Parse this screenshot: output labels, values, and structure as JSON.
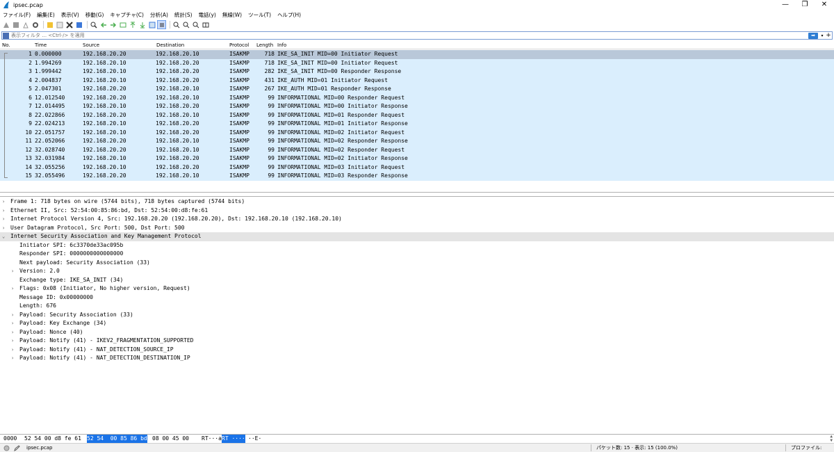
{
  "window": {
    "title": "ipsec.pcap",
    "minimize": "—",
    "restore": "❐",
    "close": "✕"
  },
  "menu": [
    "ファイル(F)",
    "編集(E)",
    "表示(V)",
    "移動(G)",
    "キャプチャ(C)",
    "分析(A)",
    "統計(S)",
    "電話(y)",
    "無線(W)",
    "ツール(T)",
    "ヘルプ(H)"
  ],
  "filter": {
    "placeholder": "表示フィルタ … <Ctrl-/> を適用",
    "apply": "➡",
    "dropdown": "▾",
    "add": "+"
  },
  "columns": {
    "no": "No.",
    "time": "Time",
    "source": "Source",
    "destination": "Destination",
    "protocol": "Protocol",
    "length": "Length",
    "info": "Info"
  },
  "packets": [
    {
      "no": "1",
      "time": "0.000000",
      "src": "192.168.20.20",
      "dst": "192.168.20.10",
      "proto": "ISAKMP",
      "len": "718",
      "info": "IKE_SA_INIT MID=00 Initiator Request"
    },
    {
      "no": "2",
      "time": "1.994269",
      "src": "192.168.20.10",
      "dst": "192.168.20.20",
      "proto": "ISAKMP",
      "len": "718",
      "info": "IKE_SA_INIT MID=00 Initiator Request"
    },
    {
      "no": "3",
      "time": "1.999442",
      "src": "192.168.20.10",
      "dst": "192.168.20.20",
      "proto": "ISAKMP",
      "len": "282",
      "info": "IKE_SA_INIT MID=00 Responder Response"
    },
    {
      "no": "4",
      "time": "2.004837",
      "src": "192.168.20.10",
      "dst": "192.168.20.20",
      "proto": "ISAKMP",
      "len": "431",
      "info": "IKE_AUTH MID=01 Initiator Request"
    },
    {
      "no": "5",
      "time": "2.047301",
      "src": "192.168.20.20",
      "dst": "192.168.20.10",
      "proto": "ISAKMP",
      "len": "267",
      "info": "IKE_AUTH MID=01 Responder Response"
    },
    {
      "no": "6",
      "time": "12.012540",
      "src": "192.168.20.20",
      "dst": "192.168.20.10",
      "proto": "ISAKMP",
      "len": "99",
      "info": "INFORMATIONAL MID=00 Responder Request"
    },
    {
      "no": "7",
      "time": "12.014495",
      "src": "192.168.20.10",
      "dst": "192.168.20.20",
      "proto": "ISAKMP",
      "len": "99",
      "info": "INFORMATIONAL MID=00 Initiator Response"
    },
    {
      "no": "8",
      "time": "22.022866",
      "src": "192.168.20.20",
      "dst": "192.168.20.10",
      "proto": "ISAKMP",
      "len": "99",
      "info": "INFORMATIONAL MID=01 Responder Request"
    },
    {
      "no": "9",
      "time": "22.024213",
      "src": "192.168.20.10",
      "dst": "192.168.20.20",
      "proto": "ISAKMP",
      "len": "99",
      "info": "INFORMATIONAL MID=01 Initiator Response"
    },
    {
      "no": "10",
      "time": "22.051757",
      "src": "192.168.20.10",
      "dst": "192.168.20.20",
      "proto": "ISAKMP",
      "len": "99",
      "info": "INFORMATIONAL MID=02 Initiator Request"
    },
    {
      "no": "11",
      "time": "22.052066",
      "src": "192.168.20.20",
      "dst": "192.168.20.10",
      "proto": "ISAKMP",
      "len": "99",
      "info": "INFORMATIONAL MID=02 Responder Response"
    },
    {
      "no": "12",
      "time": "32.028740",
      "src": "192.168.20.20",
      "dst": "192.168.20.10",
      "proto": "ISAKMP",
      "len": "99",
      "info": "INFORMATIONAL MID=02 Responder Request"
    },
    {
      "no": "13",
      "time": "32.031984",
      "src": "192.168.20.10",
      "dst": "192.168.20.20",
      "proto": "ISAKMP",
      "len": "99",
      "info": "INFORMATIONAL MID=02 Initiator Response"
    },
    {
      "no": "14",
      "time": "32.055256",
      "src": "192.168.20.10",
      "dst": "192.168.20.20",
      "proto": "ISAKMP",
      "len": "99",
      "info": "INFORMATIONAL MID=03 Initiator Request"
    },
    {
      "no": "15",
      "time": "32.055496",
      "src": "192.168.20.20",
      "dst": "192.168.20.10",
      "proto": "ISAKMP",
      "len": "99",
      "info": "INFORMATIONAL MID=03 Responder Response"
    }
  ],
  "details": [
    {
      "indent": 0,
      "arrow": ">",
      "text": "Frame 1: 718 bytes on wire (5744 bits), 718 bytes captured (5744 bits)"
    },
    {
      "indent": 0,
      "arrow": ">",
      "text": "Ethernet II, Src: 52:54:00:85:86:bd, Dst: 52:54:00:d8:fe:61"
    },
    {
      "indent": 0,
      "arrow": ">",
      "text": "Internet Protocol Version 4, Src: 192.168.20.20 (192.168.20.20), Dst: 192.168.20.10 (192.168.20.10)"
    },
    {
      "indent": 0,
      "arrow": ">",
      "text": "User Datagram Protocol, Src Port: 500, Dst Port: 500"
    },
    {
      "indent": 0,
      "arrow": "v",
      "text": "Internet Security Association and Key Management Protocol",
      "highlight": true
    },
    {
      "indent": 1,
      "arrow": "",
      "text": "Initiator SPI: 6c3370de33ac095b"
    },
    {
      "indent": 1,
      "arrow": "",
      "text": "Responder SPI: 0000000000000000"
    },
    {
      "indent": 1,
      "arrow": "",
      "text": "Next payload: Security Association (33)"
    },
    {
      "indent": 1,
      "arrow": ">",
      "text": "Version: 2.0"
    },
    {
      "indent": 1,
      "arrow": "",
      "text": "Exchange type: IKE_SA_INIT (34)"
    },
    {
      "indent": 1,
      "arrow": ">",
      "text": "Flags: 0x08 (Initiator, No higher version, Request)"
    },
    {
      "indent": 1,
      "arrow": "",
      "text": "Message ID: 0x00000000"
    },
    {
      "indent": 1,
      "arrow": "",
      "text": "Length: 676"
    },
    {
      "indent": 1,
      "arrow": ">",
      "text": "Payload: Security Association (33)"
    },
    {
      "indent": 1,
      "arrow": ">",
      "text": "Payload: Key Exchange (34)"
    },
    {
      "indent": 1,
      "arrow": ">",
      "text": "Payload: Nonce (40)"
    },
    {
      "indent": 1,
      "arrow": ">",
      "text": "Payload: Notify (41) - IKEV2_FRAGMENTATION_SUPPORTED"
    },
    {
      "indent": 1,
      "arrow": ">",
      "text": "Payload: Notify (41) - NAT_DETECTION_SOURCE_IP"
    },
    {
      "indent": 1,
      "arrow": ">",
      "text": "Payload: Notify (41) - NAT_DETECTION_DESTINATION_IP"
    }
  ],
  "bytes": {
    "offset": "0000",
    "hex_a": "52 54 00 d8 fe 61",
    "hex_hi": "52 54  00 85 86 bd",
    "hex_b": "08 00 45 00",
    "ascii_a": "RT···a",
    "ascii_hi": "RT ····",
    "ascii_b": "··E·"
  },
  "status": {
    "file": "ipsec.pcap",
    "packets": "パケット数: 15 · 表示: 15 (100.0%)",
    "profile": "プロファイル: Default"
  },
  "colors": {
    "row_bg": "#daeefd",
    "selected_row": "#b9c8d9",
    "hex_highlight": "#1a73e8"
  }
}
